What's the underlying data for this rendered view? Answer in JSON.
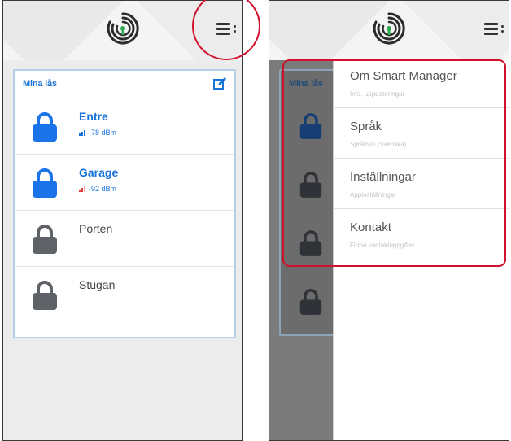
{
  "left_screen": {
    "card_title": "Mina lås",
    "locks": [
      {
        "name": "Entre",
        "signal": "-78 dBm",
        "state": "active",
        "signal_color": "#1a73d9"
      },
      {
        "name": "Garage",
        "signal": "-92 dBm",
        "state": "active",
        "signal_color": "#e33b3b"
      },
      {
        "name": "Porten",
        "signal": "",
        "state": "inactive"
      },
      {
        "name": "Stugan",
        "signal": "",
        "state": "inactive"
      }
    ]
  },
  "right_screen": {
    "card_title": "Mina lås",
    "menu": [
      {
        "title": "Om Smart Manager",
        "subtitle": "Info, uppdateringar"
      },
      {
        "title": "Språk",
        "subtitle": "Språkval (Svenska)"
      },
      {
        "title": "Inställningar",
        "subtitle": "Appinställningar"
      },
      {
        "title": "Kontakt",
        "subtitle": "Firma kontaktuppgifter"
      }
    ]
  },
  "colors": {
    "accent": "#1a73d9",
    "lock_active": "#1a73e8",
    "lock_inactive": "#5f6368",
    "annotation": "#d0112b"
  },
  "icons": [
    "app-logo-icon",
    "menu-icon",
    "edit-icon",
    "lock-icon",
    "signal-icon"
  ]
}
